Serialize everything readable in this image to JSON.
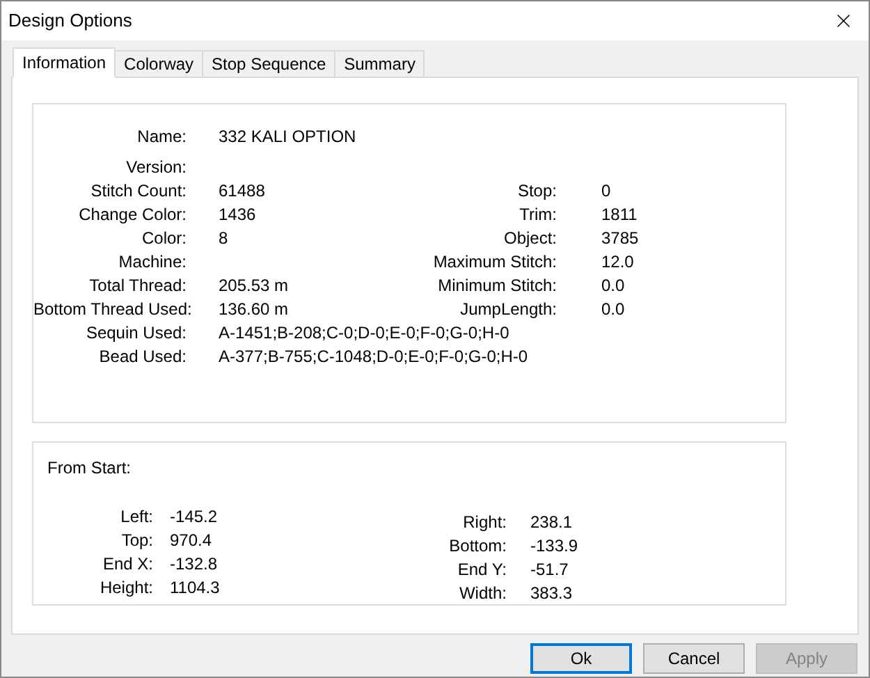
{
  "window": {
    "title": "Design Options"
  },
  "tabs": [
    {
      "label": "Information",
      "selected": true
    },
    {
      "label": "Colorway",
      "selected": false
    },
    {
      "label": "Stop Sequence",
      "selected": false
    },
    {
      "label": "Summary",
      "selected": false
    }
  ],
  "info": {
    "name": {
      "label": "Name:",
      "value": "332 KALI OPTION"
    },
    "rows": [
      {
        "label": "Version:"
      },
      {
        "label": "Stitch Count:",
        "value": "61488",
        "right": {
          "label": "Stop:",
          "value": "0"
        }
      },
      {
        "label": "Change Color:",
        "value": "1436",
        "right": {
          "label": "Trim:",
          "value": "1811"
        }
      },
      {
        "label": "Color:",
        "value": "8",
        "right": {
          "label": "Object:",
          "value": "3785"
        }
      },
      {
        "label": "Machine:",
        "right": {
          "label": "Maximum Stitch:",
          "value": "12.0"
        }
      },
      {
        "label": "Total Thread:",
        "value": "205.53 m",
        "right": {
          "label": "Minimum Stitch:",
          "value": "0.0"
        }
      },
      {
        "label": "Bottom Thread Used:",
        "value": "136.60 m",
        "right": {
          "label": "JumpLength:",
          "value": "0.0"
        }
      },
      {
        "label": "Sequin Used:",
        "value": "A-1451;B-208;C-0;D-0;E-0;F-0;G-0;H-0"
      },
      {
        "label": "Bead Used:",
        "value": "A-377;B-755;C-1048;D-0;E-0;F-0;G-0;H-0"
      }
    ]
  },
  "from_start": {
    "title": "From Start:",
    "left": [
      {
        "label": "Left:",
        "value": "-145.2"
      },
      {
        "label": "Top:",
        "value": "970.4"
      },
      {
        "label": "End X:",
        "value": "-132.8"
      },
      {
        "label": "Height:",
        "value": "1104.3"
      }
    ],
    "right": [
      {
        "label": "Right:",
        "value": "238.1"
      },
      {
        "label": "Bottom:",
        "value": "-133.9"
      },
      {
        "label": "End Y:",
        "value": "-51.7"
      },
      {
        "label": "Width:",
        "value": "383.3"
      }
    ]
  },
  "buttons": [
    {
      "label": "Ok",
      "default": true,
      "disabled": false
    },
    {
      "label": "Cancel",
      "default": false,
      "disabled": false
    },
    {
      "label": "Apply",
      "default": false,
      "disabled": true
    }
  ]
}
